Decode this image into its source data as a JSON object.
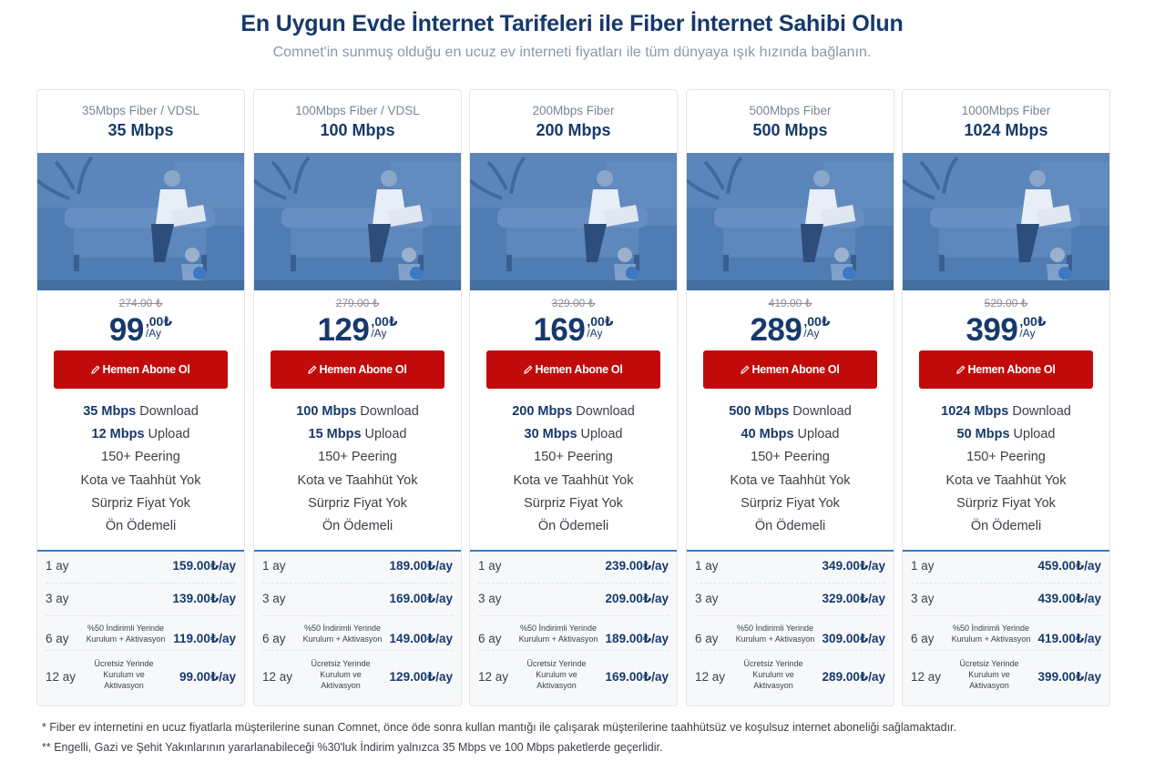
{
  "header": {
    "title": "En Uygun Evde İnternet Tarifeleri ile Fiber İnternet Sahibi Olun",
    "subtitle": "Comnet'in sunmuş olduğu en ucuz ev interneti fiyatları ile tüm dünyaya ışık hızında bağlanın."
  },
  "colors": {
    "brand": "#17396b",
    "button": "#c10b0b",
    "accent_line": "#2e7fc9"
  },
  "plans": [
    {
      "sub": "35Mbps Fiber / VDSL",
      "speed": "35 Mbps",
      "old_price": "274.00 ₺",
      "price": "99",
      "price_dec": ",00₺",
      "price_unit": "/Ay",
      "button": "Hemen Abone Ol",
      "button_icon": "pencil-icon",
      "features": [
        {
          "bold": "35 Mbps",
          "text": " Download"
        },
        {
          "bold": "12 Mbps",
          "text": " Upload"
        },
        {
          "bold": "",
          "text": "150+ Peering"
        },
        {
          "bold": "",
          "text": "Kota ve Taahhüt Yok"
        },
        {
          "bold": "",
          "text": "Sürpriz Fiyat Yok"
        },
        {
          "bold": "",
          "text": "Ön Ödemeli"
        }
      ],
      "terms": [
        {
          "period": "1 ay",
          "note": "",
          "price": "159.00₺/ay"
        },
        {
          "period": "3 ay",
          "note": "",
          "price": "139.00₺/ay"
        },
        {
          "period": "6 ay",
          "note": "%50 İndirimli Yerinde Kurulum + Aktivasyon",
          "price": "119.00₺/ay"
        },
        {
          "period": "12 ay",
          "note": "Ücretsiz Yerinde Kurulum ve Aktivasyon",
          "price": "99.00₺/ay"
        }
      ]
    },
    {
      "sub": "100Mbps Fiber / VDSL",
      "speed": "100 Mbps",
      "old_price": "279.00 ₺",
      "price": "129",
      "price_dec": ",00₺",
      "price_unit": "/Ay",
      "button": "Hemen Abone Ol",
      "button_icon": "pencil-icon",
      "features": [
        {
          "bold": "100 Mbps",
          "text": " Download"
        },
        {
          "bold": "15 Mbps",
          "text": " Upload"
        },
        {
          "bold": "",
          "text": "150+ Peering"
        },
        {
          "bold": "",
          "text": "Kota ve Taahhüt Yok"
        },
        {
          "bold": "",
          "text": "Sürpriz Fiyat Yok"
        },
        {
          "bold": "",
          "text": "Ön Ödemeli"
        }
      ],
      "terms": [
        {
          "period": "1 ay",
          "note": "",
          "price": "189.00₺/ay"
        },
        {
          "period": "3 ay",
          "note": "",
          "price": "169.00₺/ay"
        },
        {
          "period": "6 ay",
          "note": "%50 İndirimli Yerinde Kurulum + Aktivasyon",
          "price": "149.00₺/ay"
        },
        {
          "period": "12 ay",
          "note": "Ücretsiz Yerinde Kurulum ve Aktivasyon",
          "price": "129.00₺/ay"
        }
      ]
    },
    {
      "sub": "200Mbps Fiber",
      "speed": "200 Mbps",
      "old_price": "329.00 ₺",
      "price": "169",
      "price_dec": ",00₺",
      "price_unit": "/Ay",
      "button": "Hemen Abone Ol",
      "button_icon": "pencil-icon",
      "features": [
        {
          "bold": "200 Mbps",
          "text": " Download"
        },
        {
          "bold": "30 Mbps",
          "text": " Upload"
        },
        {
          "bold": "",
          "text": "150+ Peering"
        },
        {
          "bold": "",
          "text": "Kota ve Taahhüt Yok"
        },
        {
          "bold": "",
          "text": "Sürpriz Fiyat Yok"
        },
        {
          "bold": "",
          "text": "Ön Ödemeli"
        }
      ],
      "terms": [
        {
          "period": "1 ay",
          "note": "",
          "price": "239.00₺/ay"
        },
        {
          "period": "3 ay",
          "note": "",
          "price": "209.00₺/ay"
        },
        {
          "period": "6 ay",
          "note": "%50 İndirimli Yerinde Kurulum + Aktivasyon",
          "price": "189.00₺/ay"
        },
        {
          "period": "12 ay",
          "note": "Ücretsiz Yerinde Kurulum ve Aktivasyon",
          "price": "169.00₺/ay"
        }
      ]
    },
    {
      "sub": "500Mbps Fiber",
      "speed": "500 Mbps",
      "old_price": "419.00 ₺",
      "price": "289",
      "price_dec": ",00₺",
      "price_unit": "/Ay",
      "button": "Hemen Abone Ol",
      "button_icon": "pencil-icon",
      "features": [
        {
          "bold": "500 Mbps",
          "text": " Download"
        },
        {
          "bold": "40 Mbps",
          "text": " Upload"
        },
        {
          "bold": "",
          "text": "150+ Peering"
        },
        {
          "bold": "",
          "text": "Kota ve Taahhüt Yok"
        },
        {
          "bold": "",
          "text": "Sürpriz Fiyat Yok"
        },
        {
          "bold": "",
          "text": "Ön Ödemeli"
        }
      ],
      "terms": [
        {
          "period": "1 ay",
          "note": "",
          "price": "349.00₺/ay"
        },
        {
          "period": "3 ay",
          "note": "",
          "price": "329.00₺/ay"
        },
        {
          "period": "6 ay",
          "note": "%50 İndirimli Yerinde Kurulum + Aktivasyon",
          "price": "309.00₺/ay"
        },
        {
          "period": "12 ay",
          "note": "Ücretsiz Yerinde Kurulum ve Aktivasyon",
          "price": "289.00₺/ay"
        }
      ]
    },
    {
      "sub": "1000Mbps Fiber",
      "speed": "1024 Mbps",
      "old_price": "529.00 ₺",
      "price": "399",
      "price_dec": ",00₺",
      "price_unit": "/Ay",
      "button": "Hemen Abone Ol",
      "button_icon": "pencil-icon",
      "features": [
        {
          "bold": "1024 Mbps",
          "text": " Download"
        },
        {
          "bold": "50 Mbps",
          "text": " Upload"
        },
        {
          "bold": "",
          "text": "150+ Peering"
        },
        {
          "bold": "",
          "text": "Kota ve Taahhüt Yok"
        },
        {
          "bold": "",
          "text": "Sürpriz Fiyat Yok"
        },
        {
          "bold": "",
          "text": "Ön Ödemeli"
        }
      ],
      "terms": [
        {
          "period": "1 ay",
          "note": "",
          "price": "459.00₺/ay"
        },
        {
          "period": "3 ay",
          "note": "",
          "price": "439.00₺/ay"
        },
        {
          "period": "6 ay",
          "note": "%50 İndirimli Yerinde Kurulum + Aktivasyon",
          "price": "419.00₺/ay"
        },
        {
          "period": "12 ay",
          "note": "Ücretsiz Yerinde Kurulum ve Aktivasyon",
          "price": "399.00₺/ay"
        }
      ]
    }
  ],
  "footnotes": [
    "* Fiber ev internetini en ucuz fiyatlarla müşterilerine sunan Comnet, önce öde sonra kullan mantığı ile çalışarak müşterilerine taahhütsüz ve koşulsuz internet aboneliği sağlamaktadır.",
    "** Engelli, Gazi ve Şehit Yakınlarının yararlanabileceği %30'luk İndirim yalnızca 35 Mbps ve 100 Mbps paketlerde geçerlidir."
  ]
}
